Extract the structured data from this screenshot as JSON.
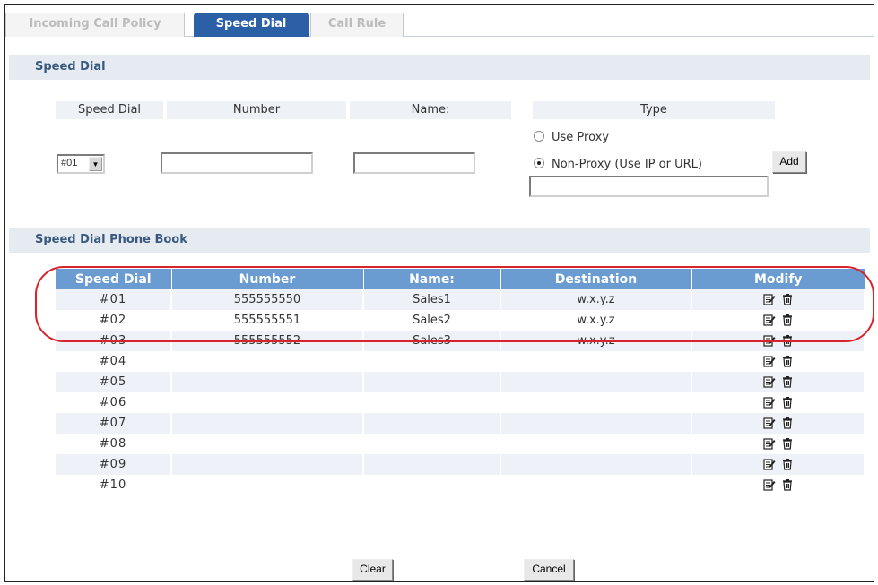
{
  "tabs": [
    {
      "label": "Incoming Call Policy",
      "active": false
    },
    {
      "label": "Speed Dial",
      "active": true
    },
    {
      "label": "Call Rule",
      "active": false
    }
  ],
  "speed_dial_section": {
    "title": "Speed Dial",
    "headers": {
      "speed_dial": "Speed Dial",
      "number": "Number",
      "name": "Name:",
      "type": "Type"
    },
    "selected_slot": "#01",
    "number_value": "",
    "name_value": "",
    "type_options": [
      {
        "label": "Use Proxy",
        "selected": false
      },
      {
        "label": "Non-Proxy (Use IP or URL)",
        "selected": true
      }
    ],
    "destination_value": "",
    "add_label": "Add"
  },
  "phone_book": {
    "title": "Speed Dial Phone Book",
    "columns": [
      "Speed Dial",
      "Number",
      "Name:",
      "Destination",
      "Modify"
    ],
    "rows": [
      {
        "slot": "#01",
        "number": "555555550",
        "name": "Sales1",
        "destination": "w.x.y.z"
      },
      {
        "slot": "#02",
        "number": "555555551",
        "name": "Sales2",
        "destination": "w.x.y.z"
      },
      {
        "slot": "#03",
        "number": "555555552",
        "name": "Sales3",
        "destination": "w.x.y.z"
      },
      {
        "slot": "#04",
        "number": "",
        "name": "",
        "destination": ""
      },
      {
        "slot": "#05",
        "number": "",
        "name": "",
        "destination": ""
      },
      {
        "slot": "#06",
        "number": "",
        "name": "",
        "destination": ""
      },
      {
        "slot": "#07",
        "number": "",
        "name": "",
        "destination": ""
      },
      {
        "slot": "#08",
        "number": "",
        "name": "",
        "destination": ""
      },
      {
        "slot": "#09",
        "number": "",
        "name": "",
        "destination": ""
      },
      {
        "slot": "#10",
        "number": "",
        "name": "",
        "destination": ""
      }
    ],
    "modify_icons": [
      "edit-icon",
      "delete-icon"
    ]
  },
  "footer": {
    "clear_label": "Clear",
    "cancel_label": "Cancel"
  },
  "colors": {
    "accent": "#2b5fa6",
    "table_header": "#6a9bd1",
    "highlight": "#d8232a",
    "section_bar": "#e6ebf1"
  }
}
